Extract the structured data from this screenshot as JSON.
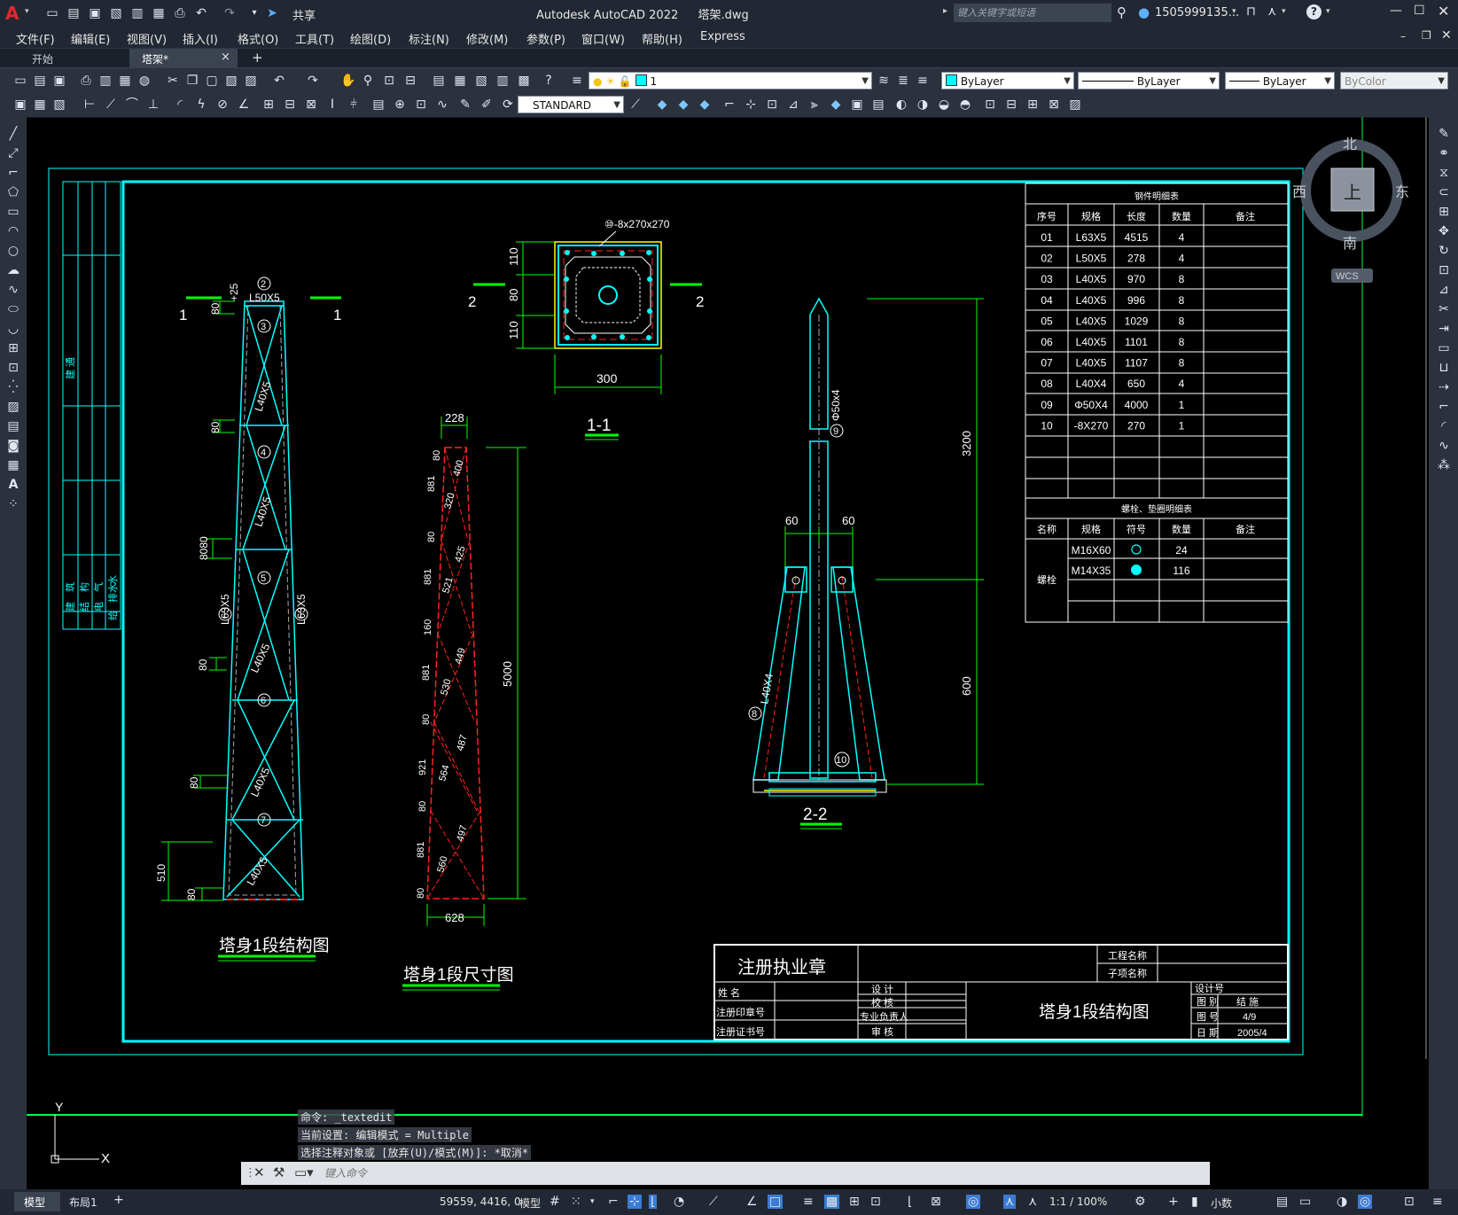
{
  "app": {
    "title": "Autodesk AutoCAD 2022",
    "filename": "塔架.dwg",
    "share_label": "共享",
    "search_placeholder": "键入关键字或短语",
    "user": "1505999135...",
    "accent": "#00ffff"
  },
  "menu": [
    "文件(F)",
    "编辑(E)",
    "视图(V)",
    "插入(I)",
    "格式(O)",
    "工具(T)",
    "绘图(D)",
    "标注(N)",
    "修改(M)",
    "参数(P)",
    "窗口(W)",
    "帮助(H)",
    "Express"
  ],
  "tabs": {
    "start": "开始",
    "active": "塔架*",
    "close": "×",
    "add": "+"
  },
  "toolbar": {
    "layer_value": "1",
    "color_value": "ByLayer",
    "linetype_value": "ByLayer",
    "lineweight_value": "ByLayer",
    "plotstyle_value": "ByColor",
    "textstyle_value": "STANDARD"
  },
  "viewcube": {
    "north": "北",
    "south": "南",
    "east": "东",
    "west": "西",
    "top": "上",
    "wcs": "WCS"
  },
  "drawing": {
    "left_strip_top": "建 通",
    "left_strip_labels": [
      "建",
      "结",
      "电",
      "给",
      "水"
    ],
    "left_strip_labels2": [
      "筑",
      "构",
      "气",
      "排水"
    ],
    "view1": {
      "title": "塔身1段结构图",
      "section_mark": "1",
      "top_label": "L50X5",
      "dim_top": "+25",
      "members": [
        "L40X5",
        "L40X5",
        "L63X5",
        "L63X5",
        "L40X5",
        "L40X5",
        "L40X5"
      ],
      "dims": [
        "80",
        "80",
        "8080",
        "80",
        "80",
        "510",
        "80"
      ],
      "balloons": [
        "2",
        "3",
        "4",
        "5",
        "6",
        "7",
        "1",
        "1"
      ]
    },
    "view2": {
      "title": "塔身1段尺寸图",
      "top": "228",
      "bottom": "628",
      "height": "5000",
      "left_dims": [
        "80",
        "881",
        "80",
        "881",
        "160",
        "881",
        "80",
        "921",
        "80",
        "881",
        "80"
      ],
      "diag": [
        "400",
        "320",
        "425",
        "521",
        "449",
        "530",
        "487",
        "564",
        "497",
        "560"
      ]
    },
    "plan": {
      "label": "⑩-8x270x270",
      "width": "300",
      "dims": [
        "110",
        "80",
        "110"
      ],
      "section_mark": "2",
      "caption": "1-1"
    },
    "elev": {
      "caption": "2-2",
      "pole": "Φ50x4",
      "pole_num": "9",
      "strut": "L40X4",
      "strut_num": "8",
      "plate_num": "10",
      "offset_l": "60",
      "offset_r": "60",
      "h1": "3200",
      "h2": "600"
    },
    "parts_table": {
      "title": "钢件明细表",
      "headers": [
        "序号",
        "规格",
        "长度",
        "数量",
        "备注"
      ],
      "rows": [
        [
          "01",
          "L63X5",
          "4515",
          "4",
          ""
        ],
        [
          "02",
          "L50X5",
          "278",
          "4",
          ""
        ],
        [
          "03",
          "L40X5",
          "970",
          "8",
          ""
        ],
        [
          "04",
          "L40X5",
          "996",
          "8",
          ""
        ],
        [
          "05",
          "L40X5",
          "1029",
          "8",
          ""
        ],
        [
          "06",
          "L40X5",
          "1101",
          "8",
          ""
        ],
        [
          "07",
          "L40X5",
          "1107",
          "8",
          ""
        ],
        [
          "08",
          "L40X4",
          "650",
          "4",
          ""
        ],
        [
          "09",
          "Φ50X4",
          "4000",
          "1",
          ""
        ],
        [
          "10",
          "-8X270",
          "270",
          "1",
          ""
        ]
      ]
    },
    "bolt_table": {
      "title": "螺栓、垫圈明细表",
      "headers": [
        "名称",
        "规格",
        "符号",
        "数量",
        "备注"
      ],
      "group": "螺栓",
      "rows": [
        [
          "M16X60",
          "24"
        ],
        [
          "M14X35",
          "116"
        ]
      ]
    },
    "title_block": {
      "stamp": "注册执业章",
      "project_name": "工程名称",
      "sub_name": "子项名称",
      "name_label": "姓  名",
      "reg_seal": "注册印章号",
      "reg_cert": "注册证书号",
      "design": "设 计",
      "check": "校 核",
      "lead": "专业负责人",
      "review": "审 核",
      "drawing_title": "塔身1段结构图",
      "design_no": "设计号",
      "category_label": "图 别",
      "category_value": "结 施",
      "no_label": "图 号",
      "no_value": "4/9",
      "date_label": "日 期",
      "date_value": "2005/4"
    }
  },
  "command": {
    "lines": [
      "命令: _textedit",
      "当前设置: 编辑模式 = Multiple",
      "选择注释对象或 [放弃(U)/模式(M)]: *取消*"
    ],
    "placeholder": "键入命令"
  },
  "ucs": {
    "x": "X",
    "y": "Y"
  },
  "status": {
    "model_tab": "模型",
    "layout_tab": "布局1",
    "coords": "59559, 4416, 0",
    "space": "模型",
    "scale": "1:1 / 100%",
    "units": "小数"
  }
}
